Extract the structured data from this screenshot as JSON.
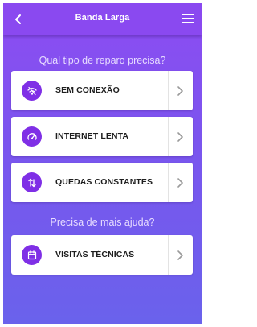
{
  "header": {
    "title": "Banda Larga",
    "back_icon": "chevron-left-icon",
    "menu_icon": "hamburger-menu-icon"
  },
  "section_repair": {
    "title": "Qual tipo de reparo precisa?",
    "items": [
      {
        "label": "SEM CONEXÃO",
        "icon": "wifi-off-icon"
      },
      {
        "label": "INTERNET LENTA",
        "icon": "speedometer-icon"
      },
      {
        "label": "QUEDAS CONSTANTES",
        "icon": "arrows-updown-icon"
      }
    ]
  },
  "section_help": {
    "title": "Precisa de mais ajuda?",
    "items": [
      {
        "label": "VISITAS TÉCNICAS",
        "icon": "calendar-icon"
      }
    ]
  },
  "colors": {
    "accent": "#7f2fe6",
    "header_bg": "#8a49f0",
    "background_top": "#8d4cf2",
    "background_bottom": "#6a62ec"
  }
}
